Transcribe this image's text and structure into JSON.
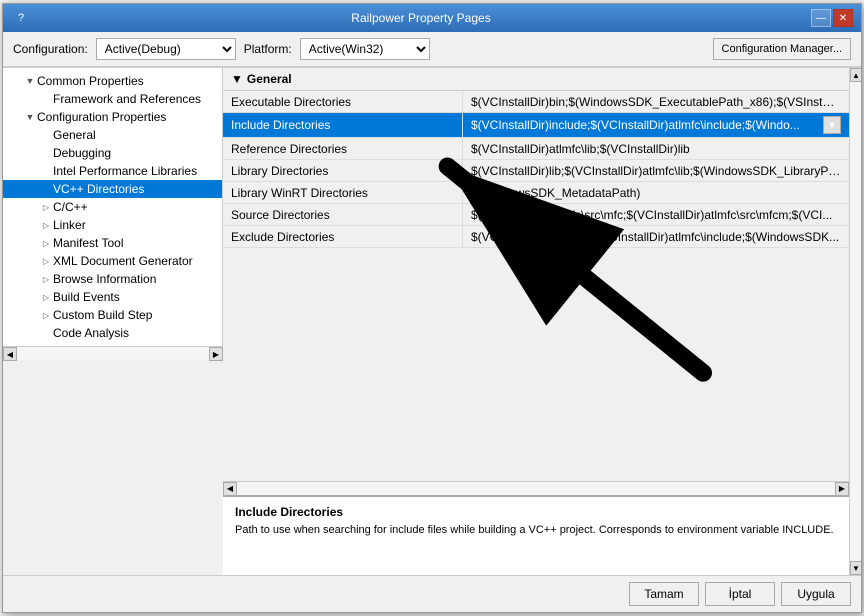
{
  "window": {
    "title": "Railpower Property Pages",
    "controls": {
      "help": "?",
      "minimize": "—",
      "close": "✕"
    }
  },
  "toolbar": {
    "config_label": "Configuration:",
    "config_value": "Active(Debug)",
    "platform_label": "Platform:",
    "platform_value": "Active(Win32)",
    "config_manager_label": "Configuration Manager..."
  },
  "left_panel": {
    "items": [
      {
        "id": "common-properties",
        "label": "Common Properties",
        "level": 0,
        "expandable": true,
        "expanded": true
      },
      {
        "id": "framework-references",
        "label": "Framework and References",
        "level": 1,
        "expandable": false
      },
      {
        "id": "config-properties",
        "label": "Configuration Properties",
        "level": 0,
        "expandable": true,
        "expanded": true
      },
      {
        "id": "general",
        "label": "General",
        "level": 1,
        "expandable": false
      },
      {
        "id": "debugging",
        "label": "Debugging",
        "level": 1,
        "expandable": false
      },
      {
        "id": "intel-perf",
        "label": "Intel Performance Libraries",
        "level": 1,
        "expandable": false
      },
      {
        "id": "vc-directories",
        "label": "VC++ Directories",
        "level": 1,
        "expandable": false,
        "selected": true
      },
      {
        "id": "cpp",
        "label": "C/C++",
        "level": 1,
        "expandable": true,
        "expanded": false
      },
      {
        "id": "linker",
        "label": "Linker",
        "level": 1,
        "expandable": true,
        "expanded": false
      },
      {
        "id": "manifest-tool",
        "label": "Manifest Tool",
        "level": 1,
        "expandable": true,
        "expanded": false
      },
      {
        "id": "xml-document",
        "label": "XML Document Generator",
        "level": 1,
        "expandable": true,
        "expanded": false
      },
      {
        "id": "browse-info",
        "label": "Browse Information",
        "level": 1,
        "expandable": true,
        "expanded": false
      },
      {
        "id": "build-events",
        "label": "Build Events",
        "level": 1,
        "expandable": true,
        "expanded": false
      },
      {
        "id": "custom-build",
        "label": "Custom Build Step",
        "level": 1,
        "expandable": true,
        "expanded": false
      },
      {
        "id": "code-analysis",
        "label": "Code Analysis",
        "level": 1,
        "expandable": false
      }
    ]
  },
  "right_panel": {
    "group_header": "General",
    "properties": [
      {
        "id": "executable-dirs",
        "name": "Executable Directories",
        "value": "$(VCInstallDir)bin;$(WindowsSDK_ExecutablePath_x86);$(VSInstallDir)...",
        "selected": false
      },
      {
        "id": "include-dirs",
        "name": "Include Directories",
        "value": "$(VCInstallDir)include;$(VCInstallDir)atlmfc\\include;$(Windo...",
        "selected": true
      },
      {
        "id": "reference-dirs",
        "name": "Reference Directories",
        "value": "$(VCInstallDir)atlmfc\\lib;$(VCInstallDir)lib",
        "selected": false
      },
      {
        "id": "library-dirs",
        "name": "Library Directories",
        "value": "$(VCInstallDir)lib;$(VCInstallDir)atlmfc\\lib;$(WindowsSDK_LibraryPa...",
        "selected": false
      },
      {
        "id": "library-winrt-dirs",
        "name": "Library WinRT Directories",
        "value": "$(WindowsSDK_MetadataPath)",
        "selected": false
      },
      {
        "id": "source-dirs",
        "name": "Source Directories",
        "value": "$(VCInstallDir)atlmfc\\src\\mfc;$(VCInstallDir)atlmfc\\src\\mfcm;$(VCI...",
        "selected": false
      },
      {
        "id": "exclude-dirs",
        "name": "Exclude Directories",
        "value": "$(VCInstallDir)include;$(VCInstallDir)atlmfc\\include;$(WindowsSDK...",
        "selected": false
      }
    ]
  },
  "info_panel": {
    "title": "Include Directories",
    "description": "Path to use when searching for include files while building a VC++ project.  Corresponds to environment variable INCLUDE."
  },
  "buttons": {
    "ok": "Tamam",
    "cancel": "İptal",
    "apply": "Uygula"
  }
}
